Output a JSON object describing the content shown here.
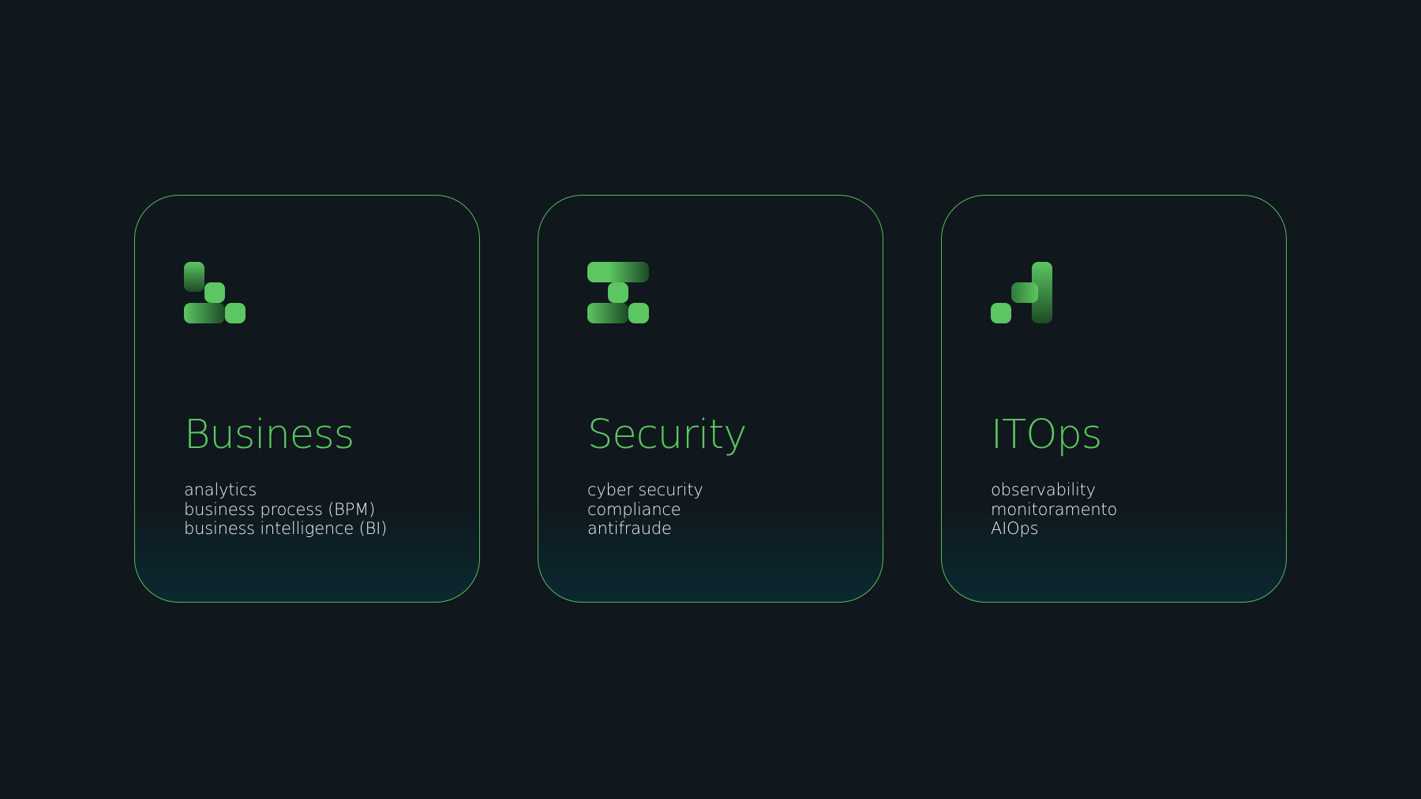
{
  "colors": {
    "background": "#10171d",
    "accent": "#5cc761",
    "border": "#58b95a",
    "text": "#eef2f4"
  },
  "cards": [
    {
      "icon": "business-stairs-icon",
      "title": "Business",
      "items": [
        "analytics",
        "business process (BPM)",
        "business intelligence (BI)"
      ]
    },
    {
      "icon": "security-z-icon",
      "title": "Security",
      "items": [
        "cyber security",
        "compliance",
        "antifraude"
      ]
    },
    {
      "icon": "itops-rising-icon",
      "title": "ITOps",
      "items": [
        "observability",
        "monitoramento",
        "AIOps"
      ]
    }
  ]
}
